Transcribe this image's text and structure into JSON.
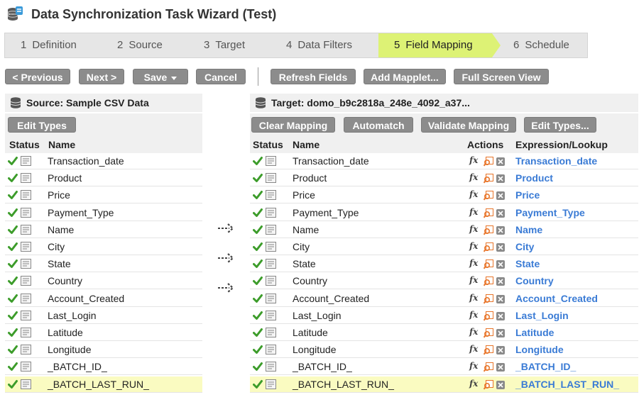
{
  "window": {
    "title": "Data Synchronization Task Wizard (Test)"
  },
  "steps": [
    {
      "num": "1",
      "label": "Definition"
    },
    {
      "num": "2",
      "label": "Source"
    },
    {
      "num": "3",
      "label": "Target"
    },
    {
      "num": "4",
      "label": "Data Filters"
    },
    {
      "num": "5",
      "label": "Field Mapping"
    },
    {
      "num": "6",
      "label": "Schedule"
    }
  ],
  "active_step": 4,
  "toolbar": {
    "previous": "< Previous",
    "next": "Next >",
    "save": "Save",
    "cancel": "Cancel",
    "refresh": "Refresh Fields",
    "mapplet": "Add Mapplet...",
    "fullscreen": "Full Screen View"
  },
  "source": {
    "header": "Source: Sample CSV Data",
    "edit_types": "Edit Types",
    "col_status": "Status",
    "col_name": "Name",
    "fields": [
      "Transaction_date",
      "Product",
      "Price",
      "Payment_Type",
      "Name",
      "City",
      "State",
      "Country",
      "Account_Created",
      "Last_Login",
      "Latitude",
      "Longitude",
      "_BATCH_ID_",
      "_BATCH_LAST_RUN_"
    ]
  },
  "target": {
    "header": "Target: domo_b9c2818a_248e_4092_a37...",
    "clear_mapping": "Clear Mapping",
    "automatch": "Automatch",
    "validate": "Validate Mapping",
    "edit_types": "Edit Types...",
    "col_status": "Status",
    "col_name": "Name",
    "col_actions": "Actions",
    "col_expr": "Expression/Lookup",
    "fx_label": "fx",
    "fields": [
      "Transaction_date",
      "Product",
      "Price",
      "Payment_Type",
      "Name",
      "City",
      "State",
      "Country",
      "Account_Created",
      "Last_Login",
      "Latitude",
      "Longitude",
      "_BATCH_ID_",
      "_BATCH_LAST_RUN_"
    ],
    "expressions": [
      "Transaction_date",
      "Product",
      "Price",
      "Payment_Type",
      "Name",
      "City",
      "State",
      "Country",
      "Account_Created",
      "Last_Login",
      "Latitude",
      "Longitude",
      "_BATCH_ID_",
      "_BATCH_LAST_RUN_"
    ]
  },
  "highlighted_row": 13,
  "arrows": {
    "symbol": "⇢"
  },
  "colors": {
    "accent_step": "#ddf275",
    "check_green": "#3c9c2a",
    "expr_blue": "#3a7bd5",
    "highlight_row": "#fafbc1"
  }
}
